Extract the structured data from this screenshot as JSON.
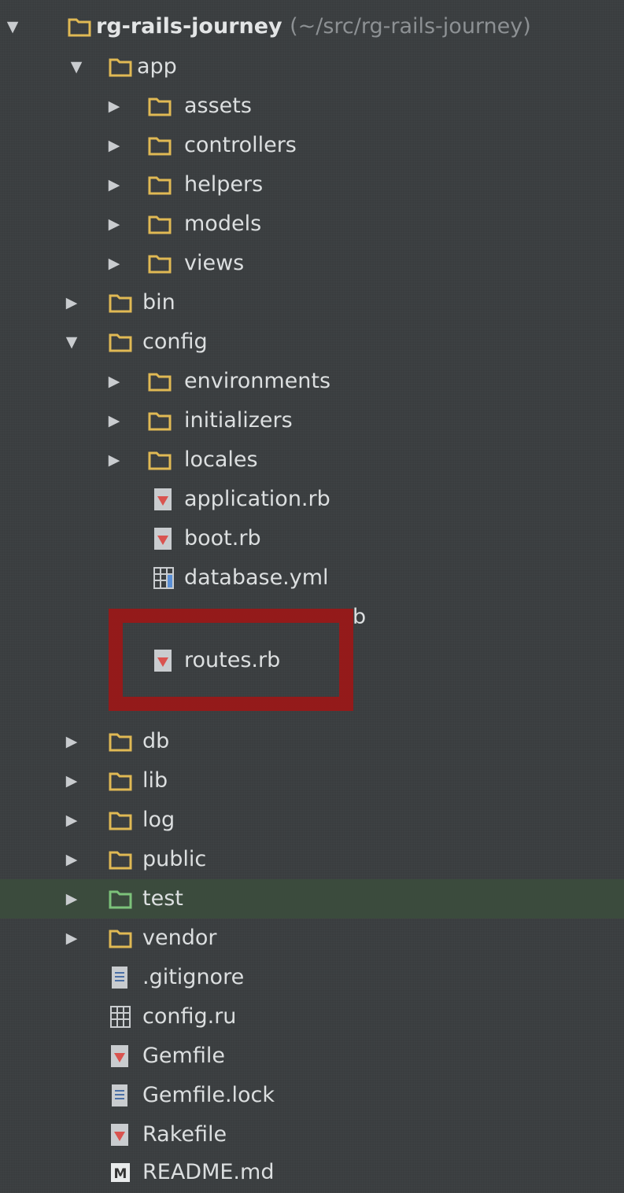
{
  "project": {
    "name": "rg-rails-journey",
    "path": "(~/src/rg-rails-journey)"
  },
  "colors": {
    "background": "#3a3d3f",
    "selected_row": "#3b4b3d",
    "folder": "#e0b954",
    "test_folder": "#7cc27a",
    "ruby_file": "#d9534f",
    "highlight_box": "#a01616"
  },
  "tree": [
    {
      "label": "rg-rails-journey",
      "type": "root",
      "expanded": true,
      "icon": "folder-icon"
    },
    {
      "label": "app",
      "type": "folder",
      "expanded": true,
      "icon": "folder-icon"
    },
    {
      "label": "assets",
      "type": "folder",
      "expanded": false,
      "icon": "folder-icon"
    },
    {
      "label": "controllers",
      "type": "folder",
      "expanded": false,
      "icon": "folder-icon"
    },
    {
      "label": "helpers",
      "type": "folder",
      "expanded": false,
      "icon": "folder-icon"
    },
    {
      "label": "models",
      "type": "folder",
      "expanded": false,
      "icon": "folder-icon"
    },
    {
      "label": "views",
      "type": "folder",
      "expanded": false,
      "icon": "folder-icon"
    },
    {
      "label": "bin",
      "type": "folder",
      "expanded": false,
      "icon": "folder-icon"
    },
    {
      "label": "config",
      "type": "folder",
      "expanded": true,
      "icon": "folder-icon"
    },
    {
      "label": "environments",
      "type": "folder",
      "expanded": false,
      "icon": "folder-icon"
    },
    {
      "label": "initializers",
      "type": "folder",
      "expanded": false,
      "icon": "folder-icon"
    },
    {
      "label": "locales",
      "type": "folder",
      "expanded": false,
      "icon": "folder-icon"
    },
    {
      "label": "application.rb",
      "type": "file",
      "icon": "ruby-file-icon"
    },
    {
      "label": "boot.rb",
      "type": "file",
      "icon": "ruby-file-icon"
    },
    {
      "label": "database.yml",
      "type": "file",
      "icon": "yaml-file-icon"
    },
    {
      "label": "b",
      "type": "file-obscured",
      "icon": "ruby-file-icon"
    },
    {
      "label": "routes.rb",
      "type": "file",
      "icon": "ruby-file-icon"
    },
    {
      "label": "",
      "type": "file-obscured",
      "icon": "yaml-file-icon"
    },
    {
      "label": "db",
      "type": "folder",
      "expanded": false,
      "icon": "folder-icon"
    },
    {
      "label": "lib",
      "type": "folder",
      "expanded": false,
      "icon": "folder-icon"
    },
    {
      "label": "log",
      "type": "folder",
      "expanded": false,
      "icon": "folder-icon"
    },
    {
      "label": "public",
      "type": "folder",
      "expanded": false,
      "icon": "folder-icon"
    },
    {
      "label": "test",
      "type": "folder",
      "expanded": false,
      "icon": "test-folder-icon",
      "selected": true
    },
    {
      "label": "vendor",
      "type": "folder",
      "expanded": false,
      "icon": "folder-icon"
    },
    {
      "label": ".gitignore",
      "type": "file",
      "icon": "text-file-icon"
    },
    {
      "label": "config.ru",
      "type": "file",
      "icon": "config-file-icon"
    },
    {
      "label": "Gemfile",
      "type": "file",
      "icon": "ruby-file-icon"
    },
    {
      "label": "Gemfile.lock",
      "type": "file",
      "icon": "text-file-icon"
    },
    {
      "label": "Rakefile",
      "type": "file",
      "icon": "ruby-file-icon"
    },
    {
      "label": "README.md",
      "type": "file",
      "icon": "markdown-file-icon"
    }
  ],
  "icons": {
    "expanded_arrow": "▼",
    "collapsed_arrow": "▶",
    "markdown_glyph": "M"
  }
}
